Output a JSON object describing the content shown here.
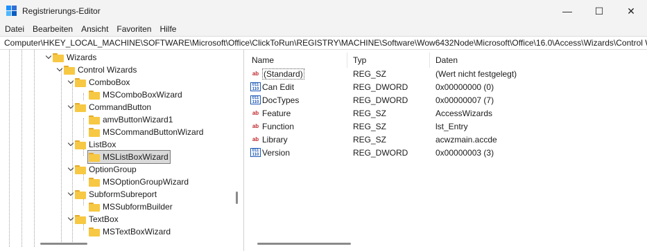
{
  "window": {
    "title": "Registrierungs-Editor",
    "minimize_glyph": "—",
    "maximize_glyph": "☐",
    "close_glyph": "✕",
    "icon_colors": [
      "#1e90ff",
      "#2f6fd6",
      "#4fb7ff",
      "#0a5cc2"
    ]
  },
  "menu": [
    "Datei",
    "Bearbeiten",
    "Ansicht",
    "Favoriten",
    "Hilfe"
  ],
  "address": "Computer\\HKEY_LOCAL_MACHINE\\SOFTWARE\\Microsoft\\Office\\ClickToRun\\REGISTRY\\MACHINE\\Software\\Wow6432Node\\Microsoft\\Office\\16.0\\Access\\Wizards\\Control W",
  "tree": {
    "nodes": [
      {
        "label": "Wizards",
        "expanded": true
      },
      {
        "label": "Control Wizards",
        "expanded": true
      },
      {
        "label": "ComboBox",
        "expanded": true
      },
      {
        "label": "MSComboBoxWizard",
        "expanded": false
      },
      {
        "label": "CommandButton",
        "expanded": true
      },
      {
        "label": "amvButtonWizard1",
        "expanded": false
      },
      {
        "label": "MSCommandButtonWizard",
        "expanded": false
      },
      {
        "label": "ListBox",
        "expanded": true
      },
      {
        "label": "MSListBoxWizard",
        "expanded": false,
        "selected": true
      },
      {
        "label": "OptionGroup",
        "expanded": true
      },
      {
        "label": "MSOptionGroupWizard",
        "expanded": false
      },
      {
        "label": "SubformSubreport",
        "expanded": true
      },
      {
        "label": "MSSubformBuilder",
        "expanded": false
      },
      {
        "label": "TextBox",
        "expanded": true
      },
      {
        "label": "MSTextBoxWizard",
        "expanded": false
      }
    ]
  },
  "list": {
    "columns": [
      "Name",
      "Typ",
      "Daten"
    ],
    "rows": [
      {
        "name": "(Standard)",
        "type": "REG_SZ",
        "data": "(Wert nicht festgelegt)",
        "icon": "string-value-icon"
      },
      {
        "name": "Can Edit",
        "type": "REG_DWORD",
        "data": "0x00000000 (0)",
        "icon": "dword-value-icon"
      },
      {
        "name": "DocTypes",
        "type": "REG_DWORD",
        "data": "0x00000007 (7)",
        "icon": "dword-value-icon"
      },
      {
        "name": "Feature",
        "type": "REG_SZ",
        "data": "AccessWizards",
        "icon": "string-value-icon"
      },
      {
        "name": "Function",
        "type": "REG_SZ",
        "data": "lst_Entry",
        "icon": "string-value-icon"
      },
      {
        "name": "Library",
        "type": "REG_SZ",
        "data": "acwzmain.accde",
        "icon": "string-value-icon"
      },
      {
        "name": "Version",
        "type": "REG_DWORD",
        "data": "0x00000003 (3)",
        "icon": "dword-value-icon"
      }
    ]
  }
}
